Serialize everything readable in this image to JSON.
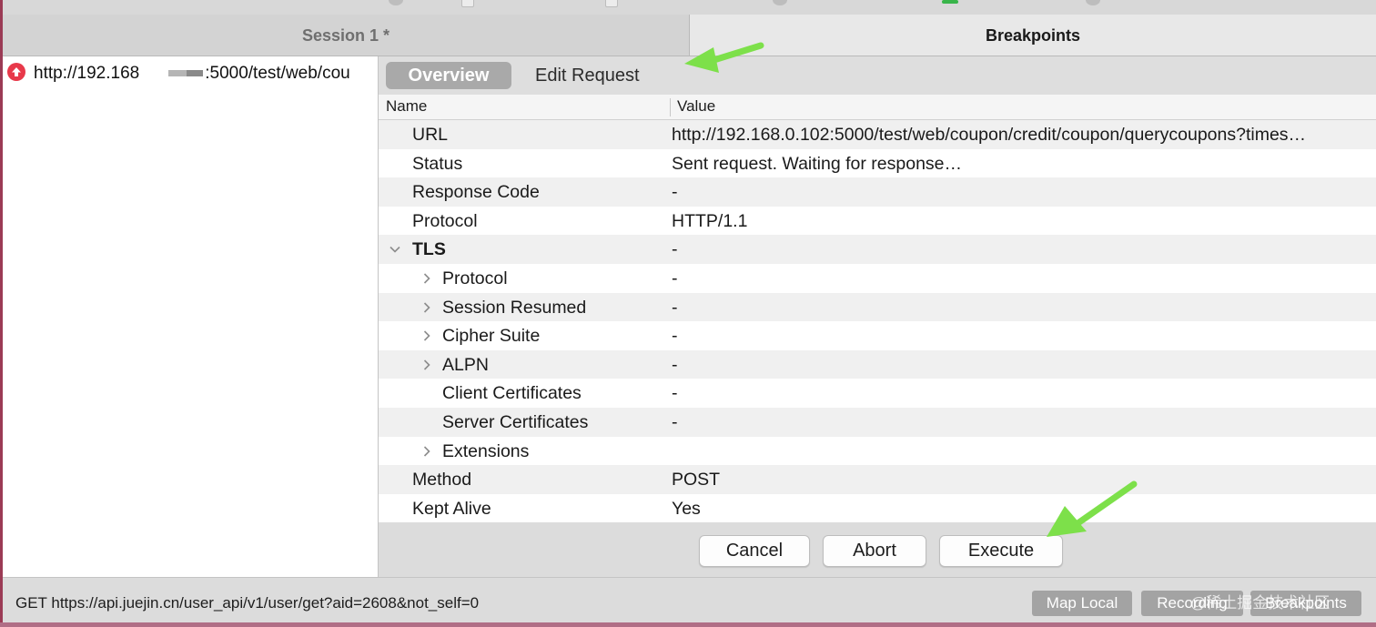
{
  "colors": {
    "overview_tab_bg": "#a9a9a9",
    "request_icon": "#e8394a",
    "status_bar_button": "#a3a3a3",
    "annotation_arrow": "#7de04a"
  },
  "tabs": {
    "session": "Session 1 *",
    "breakpoints": "Breakpoints"
  },
  "left_pane": {
    "request_url_prefix": "http://192.168",
    "request_url_suffix": ":5000/test/web/cou",
    "request_icon": "upload-arrow-icon"
  },
  "detail_tabs": {
    "overview": "Overview",
    "edit_request": "Edit Request"
  },
  "table": {
    "header": {
      "name": "Name",
      "value": "Value"
    },
    "rows": [
      {
        "name": "URL",
        "value": "http://192.168.0.102:5000/test/web/coupon/credit/coupon/querycoupons?times…"
      },
      {
        "name": "Status",
        "value": "Sent request. Waiting for response…"
      },
      {
        "name": "Response Code",
        "value": "-"
      },
      {
        "name": "Protocol",
        "value": "HTTP/1.1"
      },
      {
        "name": "TLS",
        "value": "-",
        "expanded": true
      },
      {
        "name": "Protocol",
        "value": "-",
        "collapsed": true
      },
      {
        "name": "Session Resumed",
        "value": "-",
        "collapsed": true
      },
      {
        "name": "Cipher Suite",
        "value": "-",
        "collapsed": true
      },
      {
        "name": "ALPN",
        "value": "-",
        "collapsed": true
      },
      {
        "name": "Client Certificates",
        "value": "-"
      },
      {
        "name": "Server Certificates",
        "value": "-"
      },
      {
        "name": "Extensions",
        "value": "",
        "collapsed": true
      },
      {
        "name": "Method",
        "value": "POST"
      },
      {
        "name": "Kept Alive",
        "value": "Yes"
      }
    ]
  },
  "actions": {
    "cancel": "Cancel",
    "abort": "Abort",
    "execute": "Execute"
  },
  "status_bar": {
    "text": "GET https://api.juejin.cn/user_api/v1/user/get?aid=2608&not_self=0",
    "map_local": "Map Local",
    "recording": "Recording",
    "breakpoints": "Breakpoints"
  },
  "watermark": "@稀土掘金技术社区"
}
